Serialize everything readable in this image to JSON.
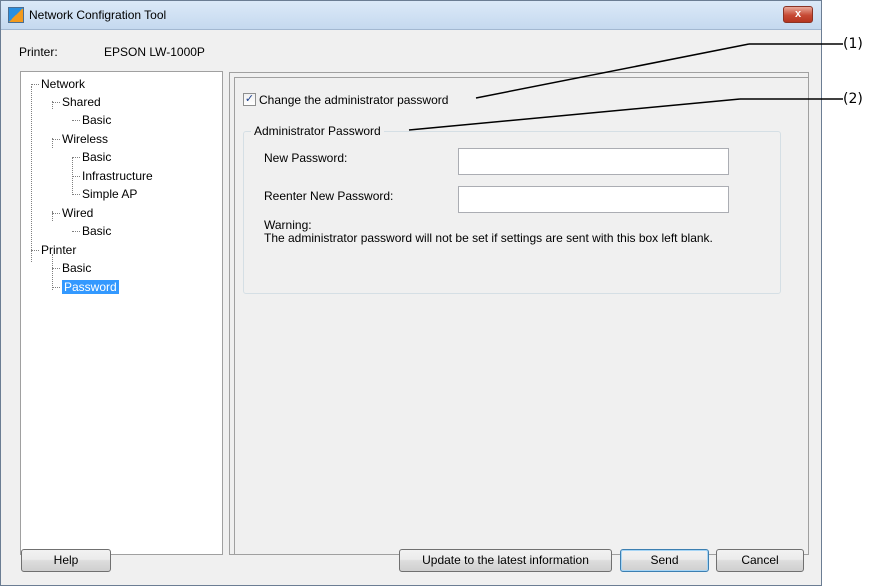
{
  "window": {
    "title": "Network Configration Tool",
    "close_label": "x"
  },
  "printer": {
    "label": "Printer:",
    "value": "EPSON LW-1000P"
  },
  "tree": {
    "items": [
      {
        "label": "Network"
      },
      {
        "label": "Shared"
      },
      {
        "label": "Basic"
      },
      {
        "label": "Wireless"
      },
      {
        "label": "Basic"
      },
      {
        "label": "Infrastructure"
      },
      {
        "label": "Simple AP"
      },
      {
        "label": "Wired"
      },
      {
        "label": "Basic"
      },
      {
        "label": "Printer"
      },
      {
        "label": "Basic"
      },
      {
        "label": "Password",
        "selected": true
      }
    ]
  },
  "content": {
    "change_password_label": "Change the administrator password",
    "change_password_checked": true,
    "group_title": "Administrator Password",
    "new_password_label": "New Password:",
    "new_password_value": "",
    "reenter_password_label": "Reenter New Password:",
    "reenter_password_value": "",
    "warning_title": "Warning:",
    "warning_text": "The administrator password will not be set if settings are sent with this box left blank."
  },
  "buttons": {
    "help": "Help",
    "update": "Update to the latest information",
    "send": "Send",
    "cancel": "Cancel"
  },
  "callouts": [
    "(1)",
    "(2)"
  ]
}
